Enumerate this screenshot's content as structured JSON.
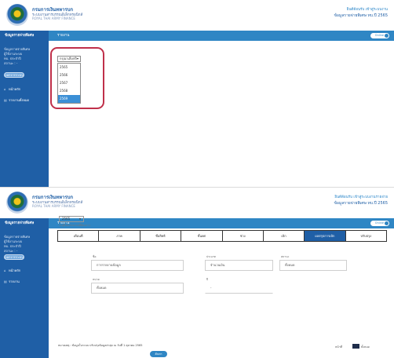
{
  "screens": [
    {
      "header": {
        "org_name": "กรมการเงินทหารบก",
        "org_sub": "ระบบงานสารบรรณอิเล็กทรอนิกส์",
        "org_sub2": "ROYAL THAI ARMY FINANCE",
        "user_line1": "ยินดีต้อนรับ เข้าสู่ระบบงาน",
        "user_line2": "ข้อมูลรายจ่ายพิเศษ ทบ.ปี 2565"
      },
      "navbar": {
        "left_title": "ข้อมูลรายจ่ายพิเศษ",
        "title": "รายงาน",
        "toggle_label": "Online"
      },
      "sidebar": {
        "user_lines": [
          "ข้อมูลรายจ่ายพิเศษ",
          "ผู้ใช้งานระบบ",
          "ทบ. ประจำปี",
          "สถานะ : -"
        ],
        "logout_label": "ออกจากระบบ",
        "menu": [
          {
            "icon": "home-icon",
            "glyph": "⌂",
            "label": "หน้าหลัก"
          },
          {
            "icon": "report-icon",
            "glyph": "▤",
            "label": "รายงานทั้งหมด"
          }
        ]
      },
      "dropdown": {
        "selected": "กรุณาเลือกปี",
        "options": [
          "2565",
          "2566",
          "2567",
          "2568",
          "2569"
        ],
        "highlighted_index": 4
      }
    },
    {
      "header": {
        "org_name": "กรมการเงินทหารบก",
        "org_sub": "ระบบงานสารบรรณอิเล็กทรอนิกส์",
        "org_sub2": "ROYAL THAI ARMY FINANCE",
        "user_line1": "ยินดีต้อนรับ เข้าสู่ระบบงานรายจ่าย",
        "user_line2": "ข้อมูลรายจ่ายพิเศษ ทบ.ปี 2565"
      },
      "navbar": {
        "left_title": "ข้อมูลรายจ่ายพิเศษ",
        "title": "รายงาน",
        "toggle_label": "Online"
      },
      "sidebar": {
        "user_lines": [
          "ข้อมูลรายจ่ายพิเศษ",
          "ผู้ใช้งานระบบ",
          "ทบ. ประจำปี",
          "สถานะ : -"
        ],
        "logout_label": "ออกจากระบบ",
        "menu": [
          {
            "icon": "home-icon",
            "glyph": "⌂",
            "label": "หน้าหลัก"
          },
          {
            "icon": "report-icon",
            "glyph": "▤",
            "label": "รายงาน"
          }
        ]
      },
      "form": {
        "year_select": "2565",
        "hint": "ระบุปีงบประมาณที่ต้องการ",
        "tabs": [
          "เดือนที่",
          "ภาค",
          "ชื่อสิทธิ",
          "ชั้นยศ",
          "ช่วง",
          "เบิก",
          "ผลสรุปการเบิก",
          "ปรับปรุง"
        ],
        "active_tab_index": 6,
        "fields": [
          {
            "label": "ชื่อ",
            "value": "การรายงานข้อมูล"
          },
          {
            "label": "ประเภท",
            "value": "จำนวนเงิน"
          },
          {
            "label": "สถานะ",
            "value": "ทั้งหมด"
          },
          {
            "label": "หน่วย",
            "value": "ทั้งหมด"
          },
          {
            "label": "ปี",
            "value": "-"
          }
        ],
        "footnote": "หมายเหตุ : ข้อมูลในระบบ ปรับปรุงข้อมูลล่าสุด ณ วันที่ 1 ตุลาคม 2565",
        "submit_label": "ค้นหา",
        "page_label": "หน้าที่",
        "page_text": "ทั้งหมด"
      }
    }
  ]
}
